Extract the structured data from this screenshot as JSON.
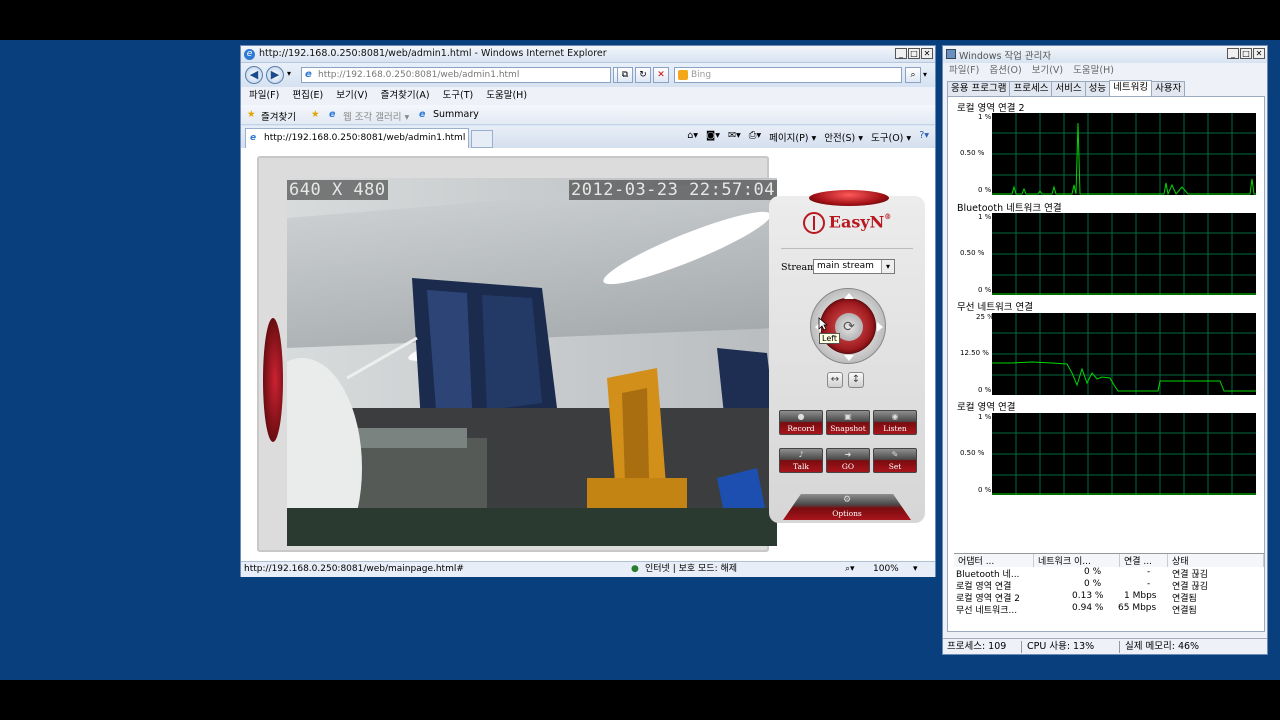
{
  "ie": {
    "title": "http://192.168.0.250:8081/web/admin1.html - Windows Internet Explorer",
    "address": "http://192.168.0.250:8081/web/admin1.html",
    "search_placeholder": "Bing",
    "menu": [
      "파일(F)",
      "편집(E)",
      "보기(V)",
      "즐겨찾기(A)",
      "도구(T)",
      "도움말(H)"
    ],
    "favorites_label": "즐겨찾기",
    "web_slice_gallery": "웹 조각 갤러리 ▾",
    "summary_link": "Summary",
    "tab_title": "http://192.168.0.250:8081/web/admin1.html",
    "cmd_page": "페이지(P) ▾",
    "cmd_safety": "안전(S) ▾",
    "cmd_tools": "도구(O) ▾",
    "status_url": "http://192.168.0.250:8081/web/mainpage.html#",
    "status_zone": "인터넷 | 보호 모드: 해제",
    "status_zoom": "100%"
  },
  "camera": {
    "resolution": "640 X 480",
    "timestamp": "2012-03-23 22:57:04",
    "brand": "EasyN",
    "stream_label": "Stream:",
    "stream_value": "main stream",
    "ptz_tooltip": "Left",
    "buttons": {
      "record": "Record",
      "snapshot": "Snapshot",
      "listen": "Listen",
      "talk": "Talk",
      "go": "GO",
      "set": "Set",
      "options": "Options"
    }
  },
  "taskmgr": {
    "title": "Windows 작업 관리자",
    "menu": [
      "파일(F)",
      "옵션(O)",
      "보기(V)",
      "도움말(H)"
    ],
    "tabs": [
      "응용 프로그램",
      "프로세스",
      "서비스",
      "성능",
      "네트워킹",
      "사용자"
    ],
    "active_tab": "네트워킹",
    "graphs": [
      {
        "title": "로컬 영역 연결 2",
        "labels": [
          "1 %",
          "0.50 %",
          "0 %"
        ],
        "color": "#00c000"
      },
      {
        "title": "Bluetooth 네트워크 연결",
        "labels": [
          "1 %",
          "0.50 %",
          "0 %"
        ],
        "color": "#00c000"
      },
      {
        "title": "무선 네트워크 연결",
        "labels": [
          "25 %",
          "12.50 %",
          "0 %"
        ],
        "color": "#00c000"
      },
      {
        "title": "로컬 영역 연결",
        "labels": [
          "1 %",
          "0.50 %",
          "0 %"
        ],
        "color": "#00c000"
      }
    ],
    "columns": [
      "어댑터 ...",
      "네트워크 이...",
      "연결 ...",
      "상태"
    ],
    "rows": [
      [
        "Bluetooth 네...",
        "0 %",
        "-",
        "연결 끊김"
      ],
      [
        "로컬 영역 연결",
        "0 %",
        "-",
        "연결 끊김"
      ],
      [
        "로컬 영역 연결 2",
        "0.13 %",
        "1 Mbps",
        "연결됨"
      ],
      [
        "무선 네트워크...",
        "0.94 %",
        "65 Mbps",
        "연결됨"
      ]
    ],
    "status_processes": "프로세스: 109",
    "status_cpu": "CPU 사용: 13%",
    "status_memory": "실제 메모리: 46%"
  }
}
